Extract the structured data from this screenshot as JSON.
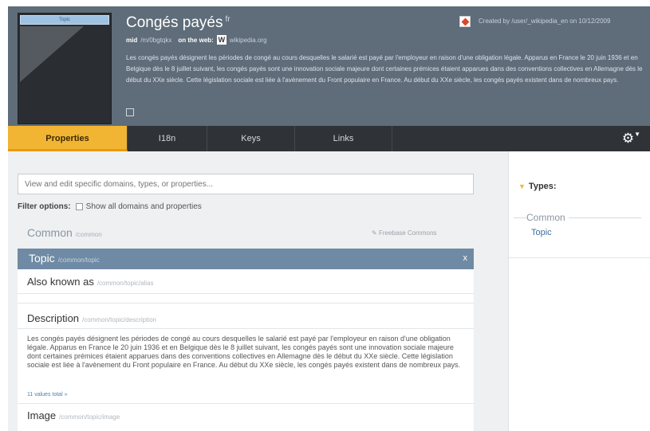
{
  "header": {
    "thumbnail_caption": "Topic",
    "title": "Congés payés",
    "title_sup": "fr",
    "mid_label": "mid",
    "mid_value": "/m/0bgtqkx",
    "web_label": "on the web:",
    "web_logo": "W",
    "web_value": "wikipedia.org",
    "description": "Les congés payés désignent les périodes de congé au cours desquelles le salarié est payé par l'employeur en raison d'une obligation légale. Apparus en France le 20 juin 1936 et en Belgique dès le 8 juillet suivant, les congés payés sont une innovation sociale majeure dont certaines prémices étaient apparues dans des conventions collectives en Allemagne dès le début du XXe siècle. Cette législation sociale est liée à l'avènement du Front populaire en France. Au début du XXe siècle, les congés payés existent dans de nombreux pays.",
    "creator": "Created by /user/_wikipedia_en on 10/12/2009"
  },
  "tabs": [
    {
      "label": "Properties",
      "active": true
    },
    {
      "label": "I18n",
      "active": false
    },
    {
      "label": "Keys",
      "active": false
    },
    {
      "label": "Links",
      "active": false
    }
  ],
  "search": {
    "placeholder": "View and edit specific domains, types, or properties..."
  },
  "filter": {
    "label": "Filter options:",
    "option": "Show all domains and properties"
  },
  "domain": {
    "name": "Common",
    "path": "/common",
    "link": "Freebase Commons"
  },
  "type": {
    "name": "Topic",
    "path": "/common/topic",
    "close": "x"
  },
  "properties": {
    "also_known_as": {
      "label": "Also known as",
      "path": "/common/topic/alias"
    },
    "description": {
      "label": "Description",
      "path": "/common/topic/description",
      "text": "Les congés payés désignent les périodes de congé au cours desquelles le salarié est payé par l'employeur en raison d'une obligation légale. Apparus en France le 20 juin 1936 et en Belgique dès le 8 juillet suivant, les congés payés sont une innovation sociale majeure dont certaines prémices étaient apparues dans des conventions collectives en Allemagne dès le début du XXe siècle. Cette législation sociale est liée à l'avènement du Front populaire en France. Au début du XXe siècle, les congés payés existent dans de nombreux pays.",
      "more": "11 values total »"
    },
    "image": {
      "label": "Image",
      "path": "/common/topic/image"
    }
  },
  "sidebar": {
    "types_label": "Types:",
    "group": "Common",
    "type": "Topic"
  },
  "icons": {
    "gear": "gear-icon",
    "creator": "freebase-user-icon"
  },
  "colors": {
    "header_bg": "#5f6c79",
    "tab_active": "#f2b533",
    "topic_bar": "#6f8aa4"
  }
}
